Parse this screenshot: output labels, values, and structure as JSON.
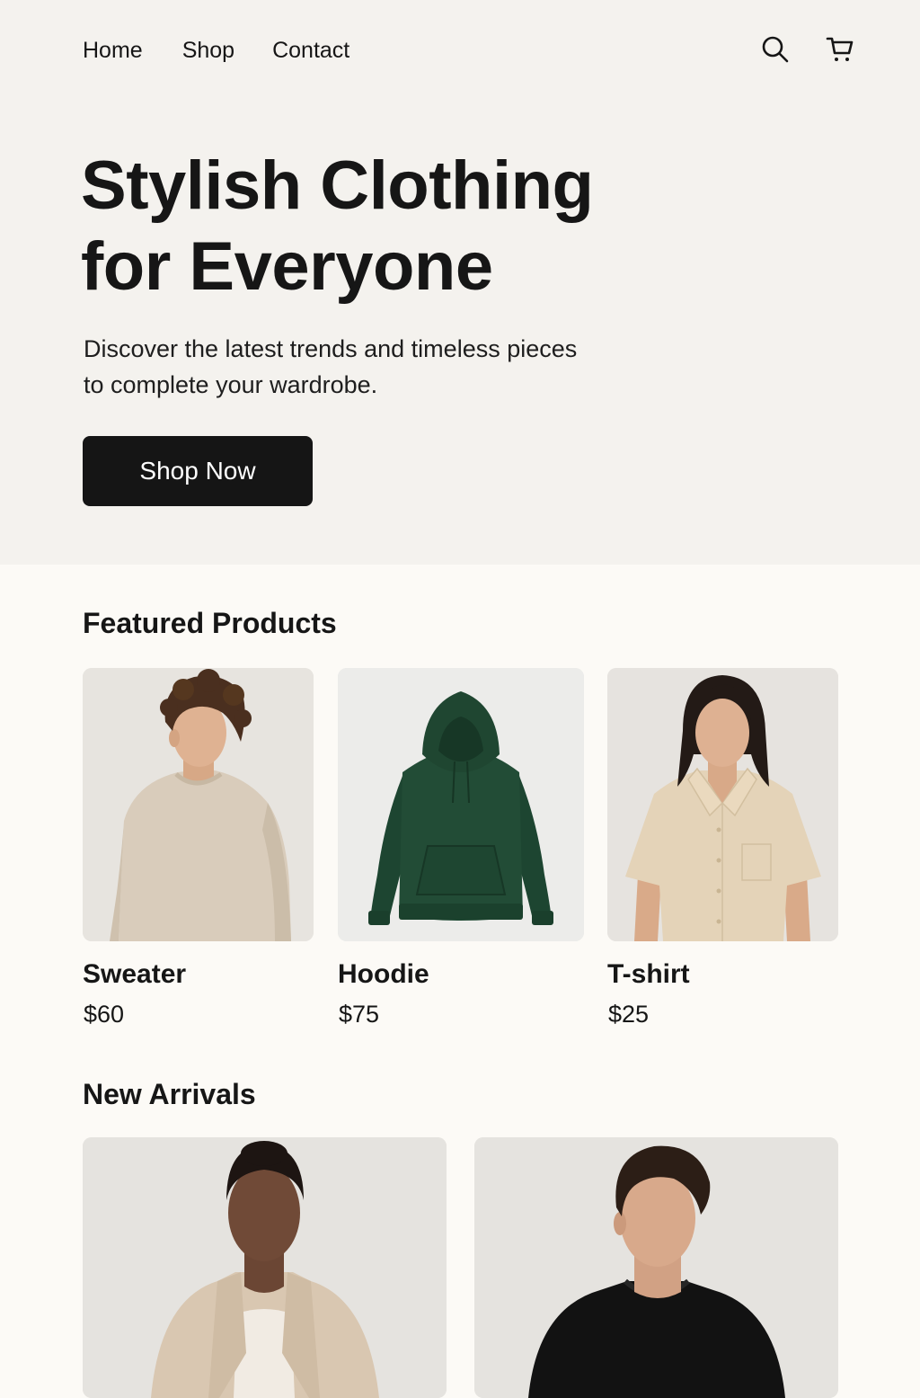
{
  "nav": {
    "links": [
      "Home",
      "Shop",
      "Contact"
    ],
    "icons": [
      "search-icon",
      "cart-icon"
    ]
  },
  "hero": {
    "title_line1": "Stylish Clothing",
    "title_line2": "for Everyone",
    "subtitle_line1": "Discover the latest trends and timeless pieces",
    "subtitle_line2": "to complete your wardrobe.",
    "cta_label": "Shop Now"
  },
  "featured": {
    "title": "Featured Products",
    "products": [
      {
        "name": "Sweater",
        "price": "$60"
      },
      {
        "name": "Hoodie",
        "price": "$75"
      },
      {
        "name": "T-shirt",
        "price": "$25"
      }
    ]
  },
  "new_arrivals": {
    "title": "New Arrivals"
  },
  "colors": {
    "hero_bg": "#f4f2ee",
    "page_bg": "#fcfaf6",
    "text": "#161616",
    "button": "#151515",
    "button_text": "#ffffff",
    "hoodie": "#1f4a33",
    "sweater": "#d8cbbb",
    "shirt": "#e4d2b6"
  }
}
